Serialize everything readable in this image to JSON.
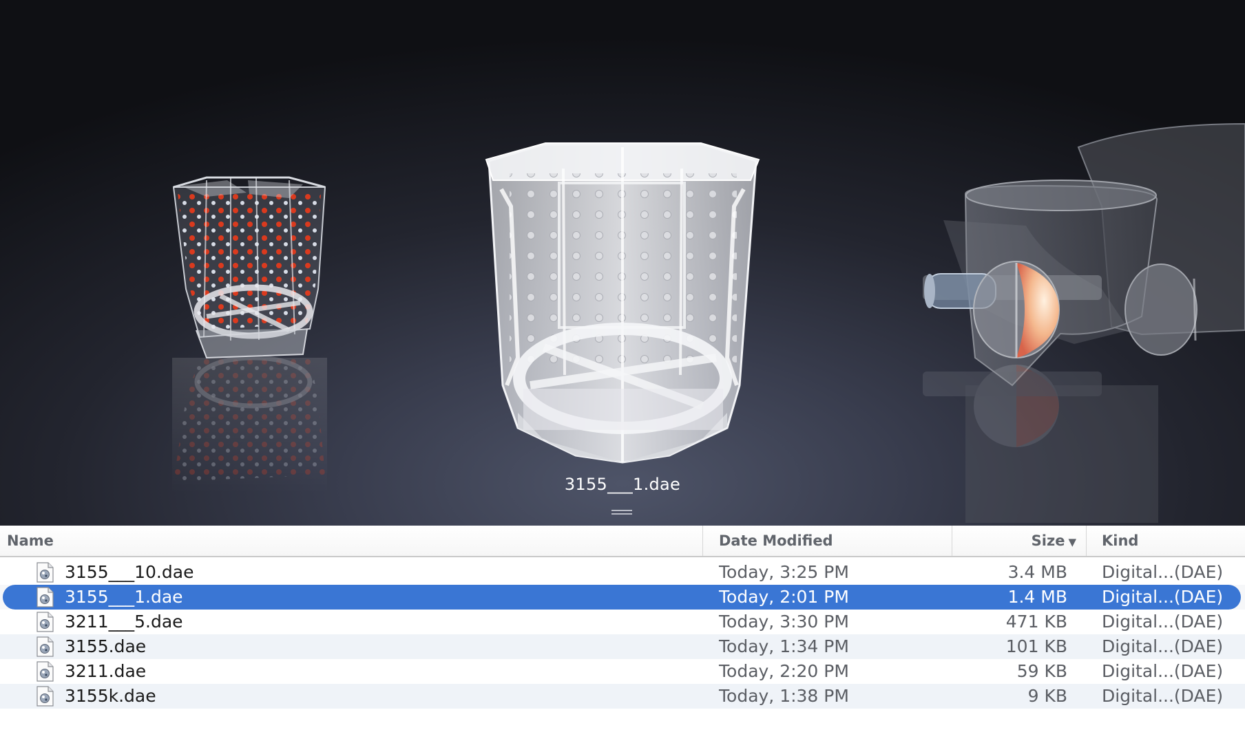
{
  "coverflow": {
    "caption": "3155___1.dae"
  },
  "columns": {
    "name": "Name",
    "date": "Date Modified",
    "size": "Size",
    "size_sort_indicator": "▼",
    "kind": "Kind"
  },
  "files": [
    {
      "name": "3155___10.dae",
      "date": "Today, 3:25 PM",
      "size": "3.4 MB",
      "kind": "Digital...(DAE)",
      "icon": "dae-file-icon"
    },
    {
      "name": "3155___1.dae",
      "date": "Today, 2:01 PM",
      "size": "1.4 MB",
      "kind": "Digital...(DAE)",
      "icon": "dae-file-icon",
      "selected": true
    },
    {
      "name": "3211___5.dae",
      "date": "Today, 3:30 PM",
      "size": "471 KB",
      "kind": "Digital...(DAE)",
      "icon": "dae-file-icon"
    },
    {
      "name": "3155.dae",
      "date": "Today, 1:34 PM",
      "size": "101 KB",
      "kind": "Digital...(DAE)",
      "icon": "dae-file-icon"
    },
    {
      "name": "3211.dae",
      "date": "Today, 2:20 PM",
      "size": "59 KB",
      "kind": "Digital...(DAE)",
      "icon": "dae-file-icon"
    },
    {
      "name": "3155k.dae",
      "date": "Today, 1:38 PM",
      "size": "9 KB",
      "kind": "Digital...(DAE)",
      "icon": "dae-file-icon"
    }
  ],
  "colors": {
    "selection": "#3a76d4",
    "accent_red": "#e33a1c"
  }
}
